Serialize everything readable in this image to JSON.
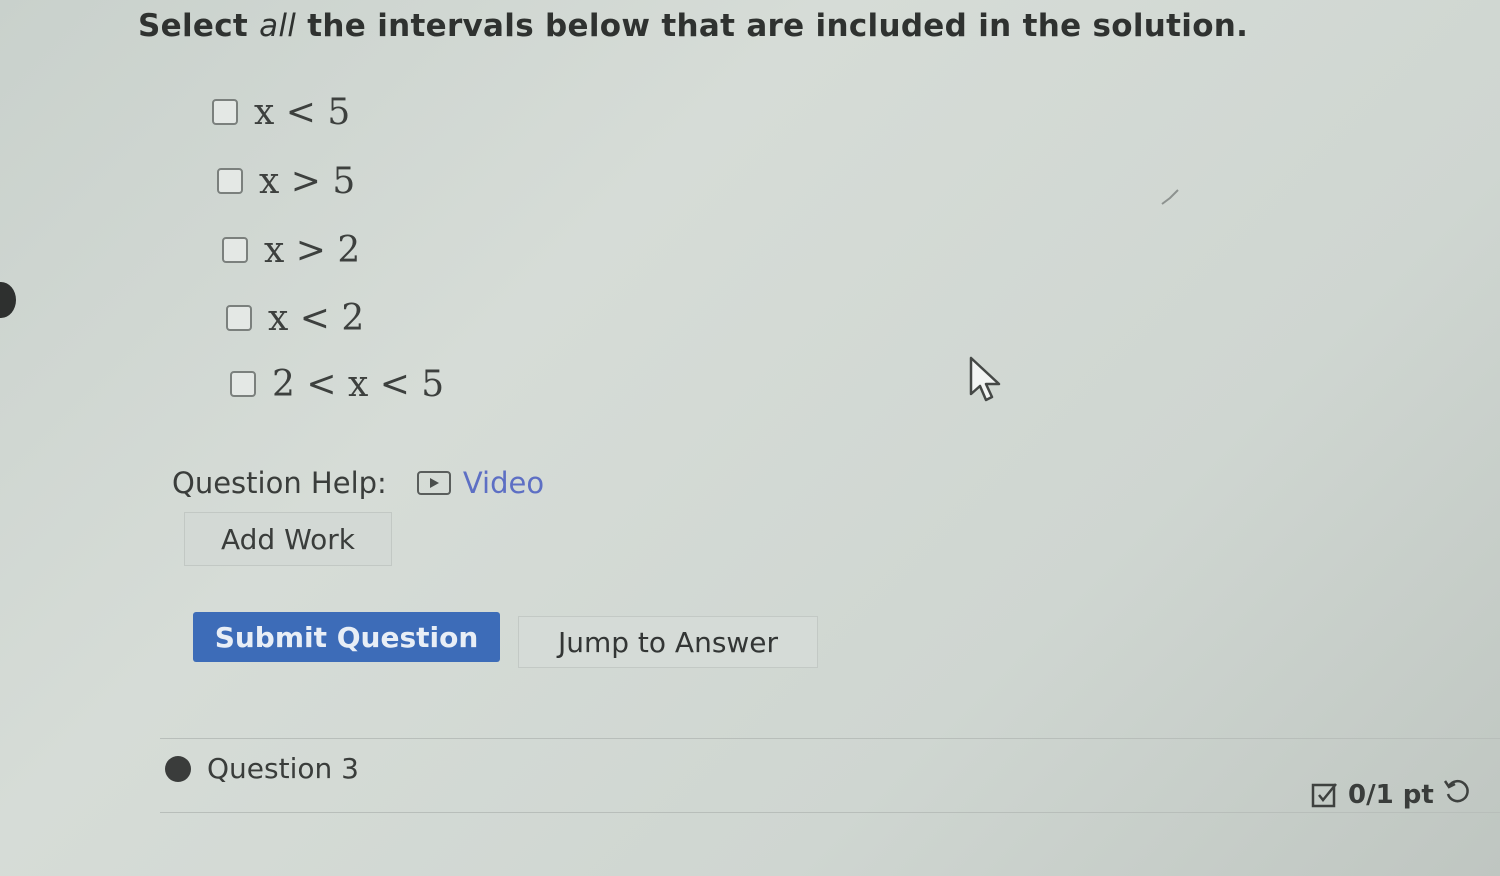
{
  "question": {
    "prompt_prefix": "Select ",
    "prompt_emphasis": "all",
    "prompt_suffix": " the intervals below that are included in the solution.",
    "options": [
      {
        "label": "x < 5"
      },
      {
        "label": "x > 5"
      },
      {
        "label": "x > 2"
      },
      {
        "label": "x < 2"
      },
      {
        "label": "2 < x < 5"
      }
    ]
  },
  "help": {
    "label": "Question Help:",
    "video_label": "Video"
  },
  "buttons": {
    "add_work": "Add Work",
    "submit": "Submit Question",
    "jump": "Jump to Answer"
  },
  "next_question": {
    "label": "Question 3",
    "points": "0/1 pt"
  },
  "icons": {
    "video": "video-play-icon",
    "points": "checkbox-edit-icon",
    "retry": "retry-icon",
    "cursor": "mouse-cursor-icon"
  },
  "colors": {
    "submit_bg": "#3d6cb8",
    "link": "#5d6fc4"
  }
}
